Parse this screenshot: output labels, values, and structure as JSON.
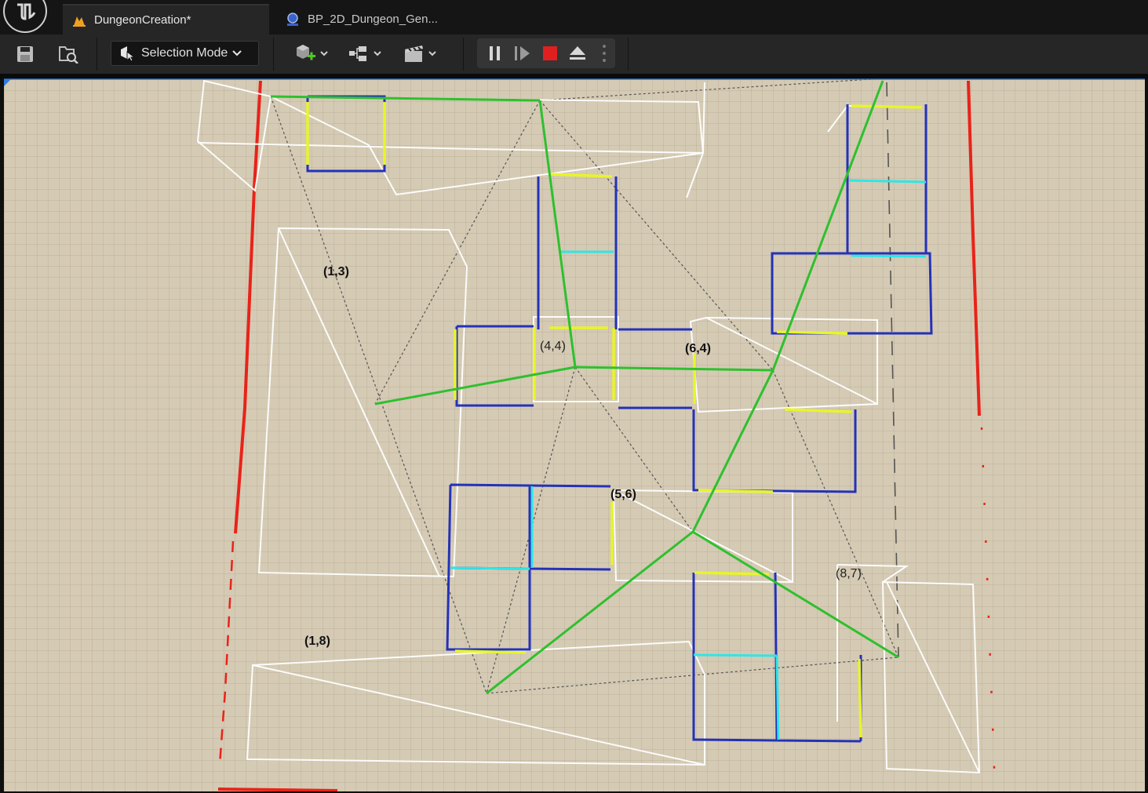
{
  "tabs": [
    {
      "label": "DungeonCreation*",
      "icon": "level-map-icon",
      "active": true
    },
    {
      "label": "BP_2D_Dungeon_Gen...",
      "icon": "blueprint-icon",
      "active": false
    }
  ],
  "toolbar": {
    "mode_label": "Selection Mode",
    "icons": [
      "save-icon",
      "browse-content-icon",
      "add-actor-icon",
      "blueprint-menu-icon",
      "cinematics-icon"
    ],
    "play_controls": [
      "pause-icon",
      "step-frame-icon",
      "stop-icon",
      "eject-icon",
      "more-options-icon"
    ]
  },
  "viewport": {
    "room_labels": [
      {
        "text": "(1,3)"
      },
      {
        "text": "(4,4)"
      },
      {
        "text": "(6,4)"
      },
      {
        "text": "(5,6)"
      },
      {
        "text": "(8,7)"
      },
      {
        "text": "(1,8)"
      }
    ],
    "colors": {
      "floor": "#d5cab4",
      "room_outline": "#ffffff",
      "wall": "#2432b8",
      "door": "#e7f52a",
      "opening": "#2ee6e6",
      "connection": "#2ec02e",
      "triangulation": "#555555",
      "boundary": "#e8231a",
      "accent": "#2f7de0"
    }
  }
}
